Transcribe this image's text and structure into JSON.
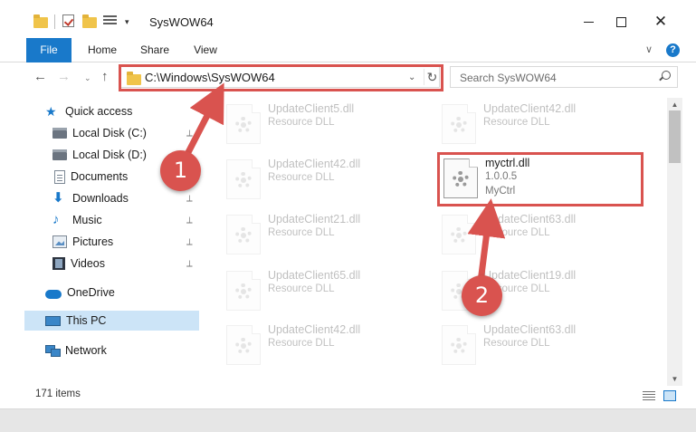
{
  "window": {
    "title": "SysWOW64",
    "controls": {
      "minimize": "minimize",
      "maximize": "maximize",
      "close": "✕"
    }
  },
  "quick_access_toolbar": {
    "icons": [
      "folder-icon",
      "properties-check-icon",
      "new-folder-icon",
      "customize-icon"
    ],
    "dropdown": "▾"
  },
  "ribbon": {
    "tabs": [
      "File",
      "Home",
      "Share",
      "View"
    ],
    "active_tab": "File",
    "help": "?",
    "expand": "∨"
  },
  "navigation": {
    "back": "←",
    "forward": "→",
    "recent": "⌄",
    "up": "↑",
    "address": "C:\\Windows\\SysWOW64",
    "address_dropdown": "⌄",
    "refresh": "↻",
    "search_placeholder": "Search SysWOW64"
  },
  "sidebar": {
    "items": [
      {
        "label": "Quick access",
        "icon": "star-icon",
        "pinned": false
      },
      {
        "label": "Local Disk (C:)",
        "icon": "disk-icon",
        "pinned": true
      },
      {
        "label": "Local Disk (D:)",
        "icon": "disk-icon",
        "pinned": true
      },
      {
        "label": "Documents",
        "icon": "documents-icon",
        "pinned": true
      },
      {
        "label": "Downloads",
        "icon": "downloads-icon",
        "pinned": true
      },
      {
        "label": "Music",
        "icon": "music-icon",
        "pinned": true
      },
      {
        "label": "Pictures",
        "icon": "pictures-icon",
        "pinned": true
      },
      {
        "label": "Videos",
        "icon": "videos-icon",
        "pinned": true
      },
      {
        "label": "OneDrive",
        "icon": "cloud-icon",
        "pinned": false
      },
      {
        "label": "This PC",
        "icon": "computer-icon",
        "pinned": false,
        "selected": true
      },
      {
        "label": "Network",
        "icon": "network-icon",
        "pinned": false
      }
    ],
    "pin_glyph": "📌"
  },
  "files": [
    {
      "name": "UpdateClient5.dll",
      "type": "Resource DLL",
      "faded": true
    },
    {
      "name": "UpdateClient42.dll",
      "type": "Resource DLL",
      "faded": true
    },
    {
      "name": "UpdateClient42.dll",
      "type": "Resource DLL",
      "faded": true
    },
    {
      "name": "myctrl.dll",
      "version": "1.0.0.5",
      "type": "MyCtrl",
      "faded": false
    },
    {
      "name": "UpdateClient21.dll",
      "type": "Resource DLL",
      "faded": true
    },
    {
      "name": "UpdateClient63.dll",
      "type": "Resource DLL",
      "faded": true
    },
    {
      "name": "UpdateClient65.dll",
      "type": "Resource DLL",
      "faded": true
    },
    {
      "name": "UpdateClient19.dll",
      "type": "Resource DLL",
      "faded": true
    },
    {
      "name": "UpdateClient42.dll",
      "type": "Resource DLL",
      "faded": true
    },
    {
      "name": "UpdateClient63.dll",
      "type": "Resource DLL",
      "faded": true
    }
  ],
  "scrollbar": {
    "up": "▲",
    "down": "▼"
  },
  "status": {
    "item_count": "171 items"
  },
  "annotations": {
    "step1": "1",
    "step2": "2",
    "color": "#d9534f"
  }
}
